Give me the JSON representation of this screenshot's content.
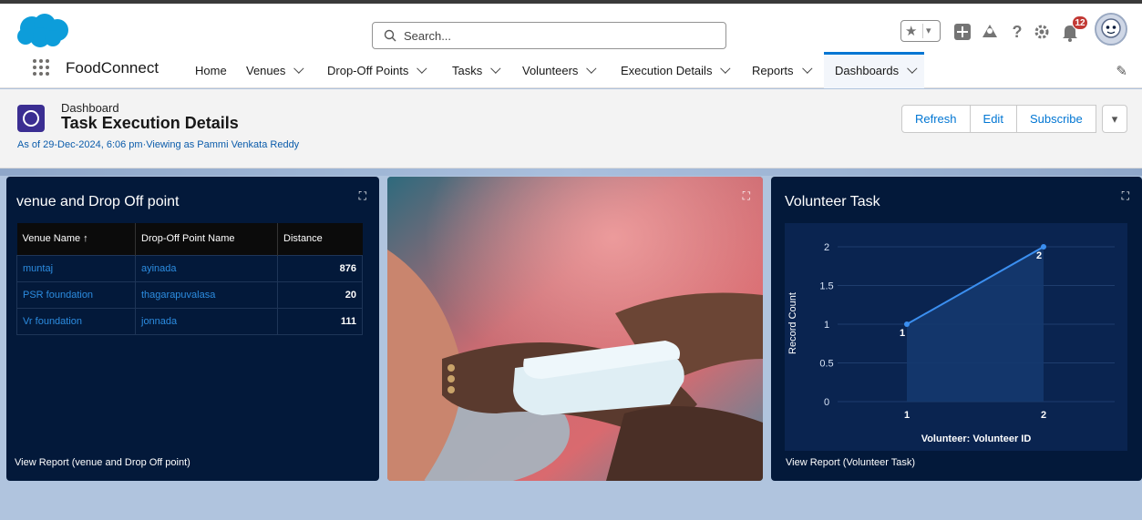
{
  "search": {
    "placeholder": "Search..."
  },
  "header": {
    "notification_count": "12"
  },
  "nav": {
    "app_name": "FoodConnect",
    "items": [
      {
        "label": "Home",
        "has_menu": false
      },
      {
        "label": "Venues",
        "has_menu": true
      },
      {
        "label": "Drop-Off Points",
        "has_menu": true
      },
      {
        "label": "Tasks",
        "has_menu": true
      },
      {
        "label": "Volunteers",
        "has_menu": true
      },
      {
        "label": "Execution Details",
        "has_menu": true
      },
      {
        "label": "Reports",
        "has_menu": true
      },
      {
        "label": "Dashboards",
        "has_menu": true,
        "active": true
      }
    ]
  },
  "dashboard": {
    "label": "Dashboard",
    "title": "Task Execution Details",
    "subtitle": "As of 29-Dec-2024, 6:06 pm·Viewing as Pammi Venkata Reddy",
    "buttons": {
      "refresh": "Refresh",
      "edit": "Edit",
      "subscribe": "Subscribe"
    }
  },
  "table_card": {
    "title": "venue and Drop Off point",
    "columns": [
      "Venue Name ↑",
      "Drop-Off Point Name",
      "Distance"
    ],
    "rows": [
      [
        "muntaj",
        "ayinada",
        "876"
      ],
      [
        "PSR foundation",
        "thagarapuvalasa",
        "20"
      ],
      [
        "Vr foundation",
        "jonnada",
        "111"
      ]
    ],
    "footer": "View Report (venue and Drop Off point)"
  },
  "chart_card": {
    "title": "Volunteer Task",
    "footer": "View Report (Volunteer Task)"
  },
  "colors": {
    "card_bg": "#03193a",
    "accent": "#0176d3",
    "line": "#3b8ff0"
  },
  "chart_data": {
    "type": "area",
    "title": "Volunteer Task",
    "x": [
      "1",
      "2"
    ],
    "series": [
      {
        "values": [
          1,
          2
        ]
      }
    ],
    "data_labels": [
      "1",
      "2"
    ],
    "xlabel": "Volunteer: Volunteer ID",
    "ylabel": "Record Count",
    "ylim": [
      0,
      2
    ],
    "yticks": [
      "0",
      "0.5",
      "1",
      "1.5",
      "2"
    ],
    "grid": true
  }
}
